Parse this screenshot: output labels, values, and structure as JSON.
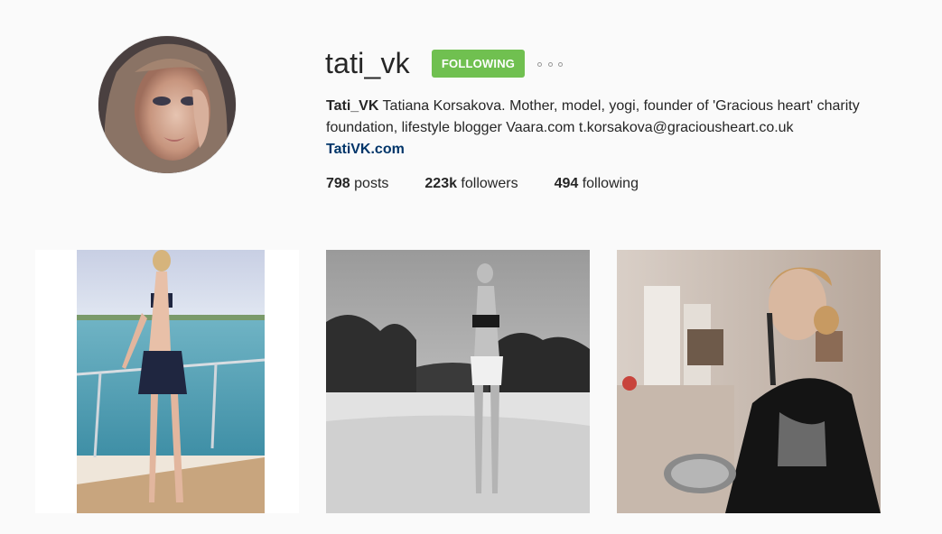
{
  "profile": {
    "username": "tati_vk",
    "follow_button_label": "FOLLOWING",
    "more_icon": "ellipsis-icon",
    "bio_name": "Tati_VK",
    "bio_text": " Tatiana Korsakova. Mother, model, yogi, founder of 'Gracious heart' charity foundation, lifestyle blogger Vaara.com t.korsakova@graciousheart.co.uk",
    "website": "TatiVK.com",
    "avatar_icon": "profile-photo"
  },
  "stats": {
    "posts_count": "798",
    "posts_label": " posts",
    "followers_count": "223k",
    "followers_label": " followers",
    "following_count": "494",
    "following_label": " following"
  },
  "colors": {
    "following_button": "#70c050",
    "link": "#003569",
    "background": "#fafafa"
  }
}
